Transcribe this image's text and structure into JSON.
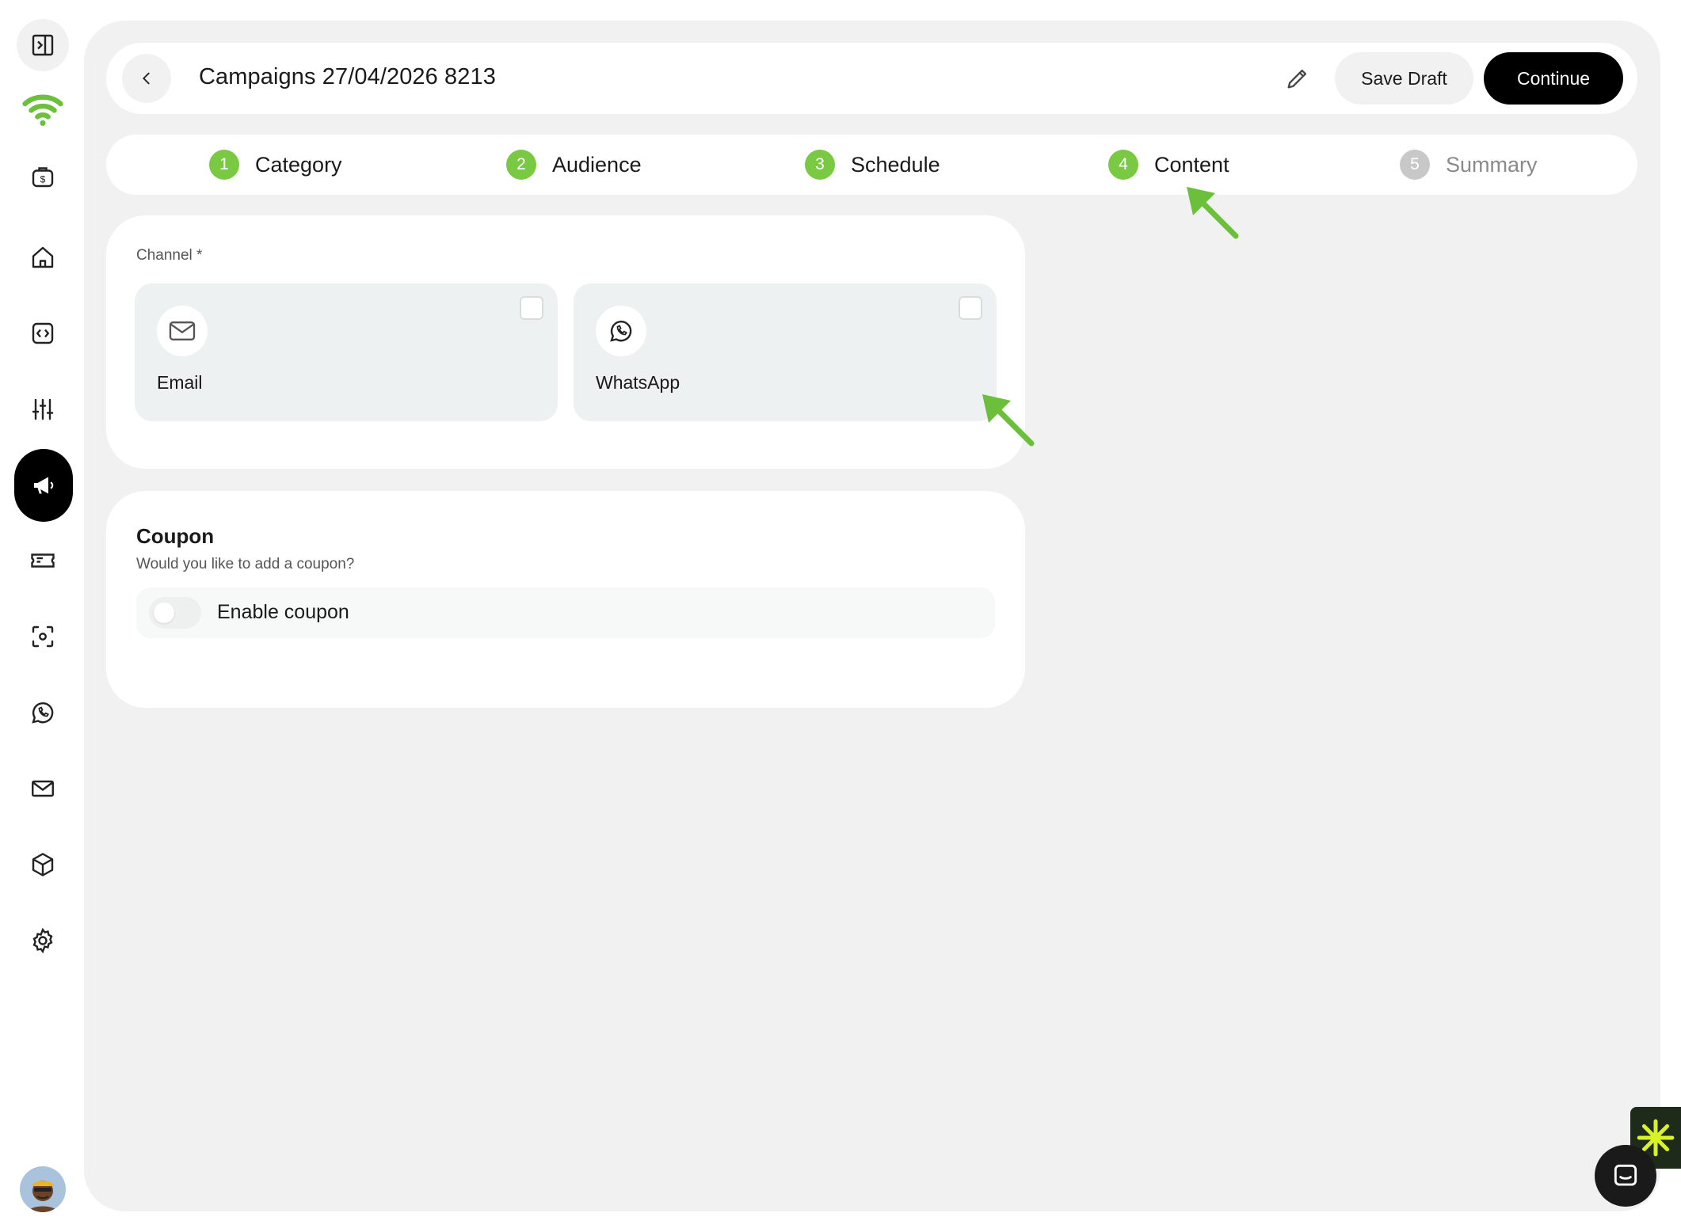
{
  "header": {
    "title": "Campaigns 27/04/2026 8213",
    "save_draft_label": "Save Draft",
    "continue_label": "Continue"
  },
  "steps": [
    {
      "num": "1",
      "label": "Category",
      "state": "complete"
    },
    {
      "num": "2",
      "label": "Audience",
      "state": "complete"
    },
    {
      "num": "3",
      "label": "Schedule",
      "state": "complete"
    },
    {
      "num": "4",
      "label": "Content",
      "state": "current"
    },
    {
      "num": "5",
      "label": "Summary",
      "state": "upcoming"
    }
  ],
  "channel": {
    "label": "Channel *",
    "options": [
      {
        "label": "Email",
        "icon": "mail-icon",
        "checked": false
      },
      {
        "label": "WhatsApp",
        "icon": "whatsapp-icon",
        "checked": false
      }
    ]
  },
  "coupon": {
    "title": "Coupon",
    "subtitle": "Would you like to add a coupon?",
    "toggle_label": "Enable coupon",
    "enabled": false
  },
  "sidebar": {
    "items": [
      {
        "icon": "sidebar-toggle-icon"
      },
      {
        "icon": "wifi-logo-icon"
      },
      {
        "icon": "money-bag-icon"
      },
      {
        "icon": "home-icon"
      },
      {
        "icon": "code-icon"
      },
      {
        "icon": "sliders-icon"
      },
      {
        "icon": "megaphone-icon",
        "active": true
      },
      {
        "icon": "ticket-icon"
      },
      {
        "icon": "scan-icon"
      },
      {
        "icon": "whatsapp-icon"
      },
      {
        "icon": "mail-icon"
      },
      {
        "icon": "box-icon"
      },
      {
        "icon": "gear-icon"
      }
    ]
  },
  "colors": {
    "accent_green": "#7ac943",
    "panel_bg": "#f1f1f1",
    "primary_button": "#000000",
    "arrow_green": "#6cbf3a"
  }
}
